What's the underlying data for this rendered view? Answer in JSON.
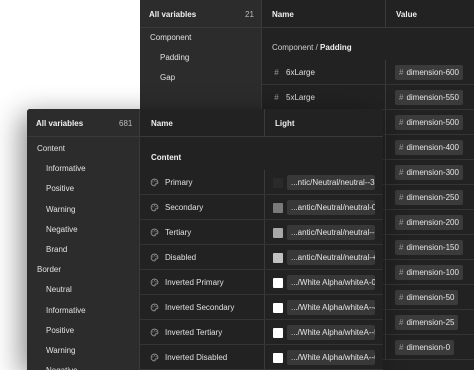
{
  "back": {
    "all_variables": "All variables",
    "count": "21",
    "sidebar": [
      "Component",
      "Padding",
      "Gap"
    ],
    "col_name": "Name",
    "col_value": "Value",
    "group_prefix": "Component / ",
    "group_name": "Padding",
    "rows": [
      {
        "name": "6xLarge",
        "value": "dimension-600"
      },
      {
        "name": "5xLarge",
        "value": "dimension-550"
      },
      {
        "name": "",
        "value": "dimension-500"
      },
      {
        "name": "",
        "value": "dimension-400"
      },
      {
        "name": "",
        "value": "dimension-300"
      },
      {
        "name": "",
        "value": "dimension-250"
      },
      {
        "name": "",
        "value": "dimension-200"
      },
      {
        "name": "",
        "value": "dimension-150"
      },
      {
        "name": "",
        "value": "dimension-100"
      },
      {
        "name": "",
        "value": "dimension-50"
      },
      {
        "name": "",
        "value": "dimension-25"
      },
      {
        "name": "",
        "value": "dimension-0"
      }
    ],
    "hash": "#"
  },
  "front": {
    "all_variables": "All variables",
    "count": "681",
    "sidebar": [
      {
        "label": "Content",
        "level": 0
      },
      {
        "label": "Informative",
        "level": 1
      },
      {
        "label": "Positive",
        "level": 1
      },
      {
        "label": "Warning",
        "level": 1
      },
      {
        "label": "Negative",
        "level": 1
      },
      {
        "label": "Brand",
        "level": 1
      },
      {
        "label": "Border",
        "level": 0
      },
      {
        "label": "Neutral",
        "level": 1
      },
      {
        "label": "Informative",
        "level": 1
      },
      {
        "label": "Positive",
        "level": 1
      },
      {
        "label": "Warning",
        "level": 1
      },
      {
        "label": "Negative",
        "level": 1
      }
    ],
    "col_name": "Name",
    "col_light": "Light",
    "group_name": "Content",
    "rows": [
      {
        "name": "Primary",
        "value": "...ntic/Neutral/neutral--3",
        "swatch": "#2a2a2a"
      },
      {
        "name": "Secondary",
        "value": "...antic/Neutral/neutral-0",
        "swatch": "#7a7a7a"
      },
      {
        "name": "Tertiary",
        "value": "...antic/Neutral/neutral--+1",
        "swatch": "#a8a8a8"
      },
      {
        "name": "Disabled",
        "value": "...antic/Neutral/neutral-+2",
        "swatch": "#c2c2c2"
      },
      {
        "name": "Inverted Primary",
        "value": ".../White Alpha/whiteA-0",
        "swatch": "#ffffff"
      },
      {
        "name": "Inverted  Secondary",
        "value": ".../White Alpha/whiteA--4",
        "swatch": "#ffffff"
      },
      {
        "name": "Inverted  Tertiary",
        "value": ".../White Alpha/whiteA--5",
        "swatch": "#ffffff"
      },
      {
        "name": "Inverted  Disabled",
        "value": ".../White Alpha/whiteA--6",
        "swatch": "#ffffff"
      }
    ]
  },
  "icons": {
    "variable": "color-variable-icon",
    "number": "number-variable-icon"
  }
}
